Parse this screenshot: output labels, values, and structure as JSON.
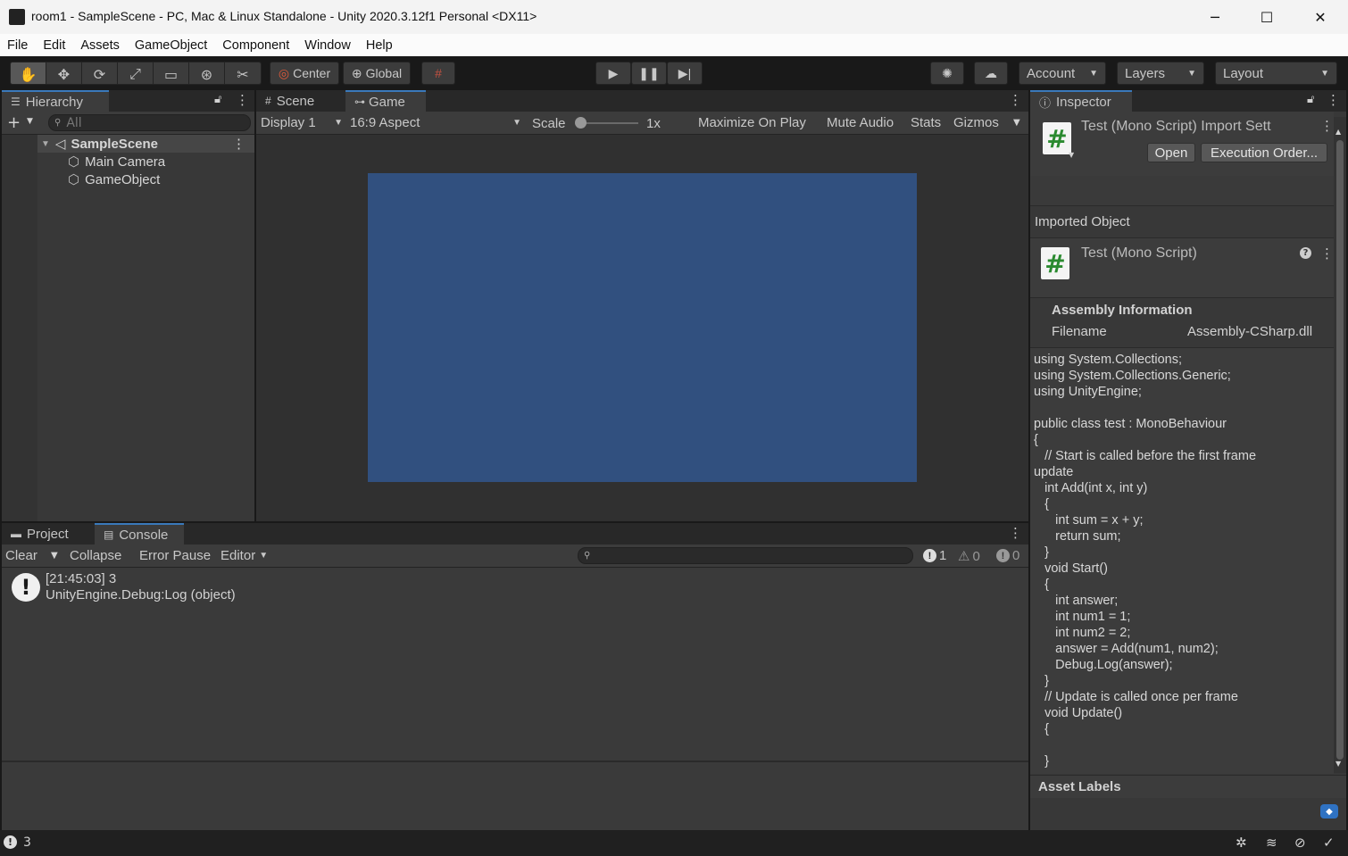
{
  "window": {
    "title": "room1 - SampleScene - PC, Mac & Linux Standalone - Unity 2020.3.12f1 Personal <DX11>",
    "minimize": "─",
    "maximize": "☐",
    "close": "✕"
  },
  "menu": [
    "File",
    "Edit",
    "Assets",
    "GameObject",
    "Component",
    "Window",
    "Help"
  ],
  "toolbar": {
    "tools": [
      "hand-icon",
      "move-icon",
      "rotate-icon",
      "scale-icon",
      "rect-icon",
      "transform-icon",
      "custom-tool-icon"
    ],
    "pivot_mode": "Center",
    "pivot_rotation": "Global",
    "account": "Account",
    "layers": "Layers",
    "layout": "Layout"
  },
  "hierarchy": {
    "tab": "Hierarchy",
    "search_placeholder": "All",
    "scene": "SampleScene",
    "items": [
      "Main Camera",
      "GameObject"
    ]
  },
  "game_view": {
    "tabs": [
      "Scene",
      "Game"
    ],
    "display": "Display 1",
    "aspect": "16:9 Aspect",
    "scale_label": "Scale",
    "scale_value": "1x",
    "maximize": "Maximize On Play",
    "mute": "Mute Audio",
    "stats": "Stats",
    "gizmos": "Gizmos",
    "viewport_color": "#31507f"
  },
  "console": {
    "tabs": [
      "Project",
      "Console"
    ],
    "clear": "Clear",
    "collapse": "Collapse",
    "error_pause": "Error Pause",
    "editor": "Editor",
    "counts": {
      "logs": "1",
      "warnings": "0",
      "errors": "0"
    },
    "entries": [
      {
        "time_msg": "[21:45:03] 3",
        "detail": "UnityEngine.Debug:Log (object)"
      }
    ]
  },
  "inspector": {
    "tab": "Inspector",
    "header_title": "Test (Mono Script) Import Sett",
    "open_btn": "Open",
    "exec_order_btn": "Execution Order...",
    "imported_object": "Imported Object",
    "script_title": "Test (Mono Script)",
    "assembly_info": "Assembly Information",
    "filename_label": "Filename",
    "filename_value": "Assembly-CSharp.dll",
    "code": "using System.Collections;\nusing System.Collections.Generic;\nusing UnityEngine;\n\npublic class test : MonoBehaviour\n{\n   // Start is called before the first frame\nupdate\n   int Add(int x, int y)\n   {\n      int sum = x + y;\n      return sum;\n   }\n   void Start()\n   {\n      int answer;\n      int num1 = 1;\n      int num2 = 2;\n      answer = Add(num1, num2);\n      Debug.Log(answer);\n   }\n   // Update is called once per frame\n   void Update()\n   {\n\n   }",
    "asset_labels": "Asset Labels"
  },
  "statusbar": {
    "message": "3"
  }
}
